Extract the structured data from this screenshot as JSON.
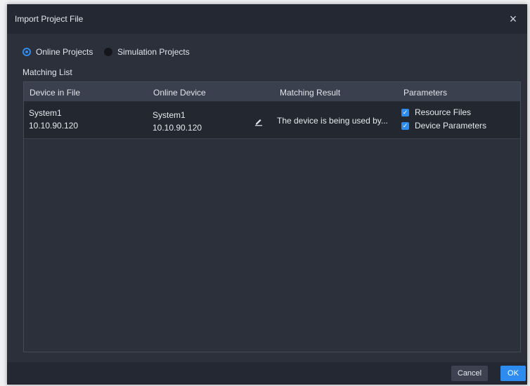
{
  "dialog": {
    "title": "Import Project File",
    "close_symbol": "×"
  },
  "mode": {
    "options": [
      {
        "label": "Online Projects",
        "selected": true
      },
      {
        "label": "Simulation Projects",
        "selected": false
      }
    ]
  },
  "matching_list": {
    "label": "Matching List",
    "columns": [
      "Device in File",
      "Online Device",
      "Matching Result",
      "Parameters"
    ],
    "rows": [
      {
        "device_in_file_name": "System1",
        "device_in_file_ip": "10.10.90.120",
        "online_device_name": "System1",
        "online_device_ip": "10.10.90.120",
        "edit_icon": "edit-pencil-icon",
        "matching_result": "The device is being used by...",
        "parameters": [
          {
            "label": "Resource Files",
            "checked": true
          },
          {
            "label": "Device Parameters",
            "checked": true
          }
        ]
      }
    ]
  },
  "footer": {
    "cancel_label": "Cancel",
    "ok_label": "OK"
  },
  "colors": {
    "accent": "#2e8cf0",
    "dialog_bg": "#2b303b",
    "header_bg": "#3a404d",
    "row_bg": "#232730"
  }
}
